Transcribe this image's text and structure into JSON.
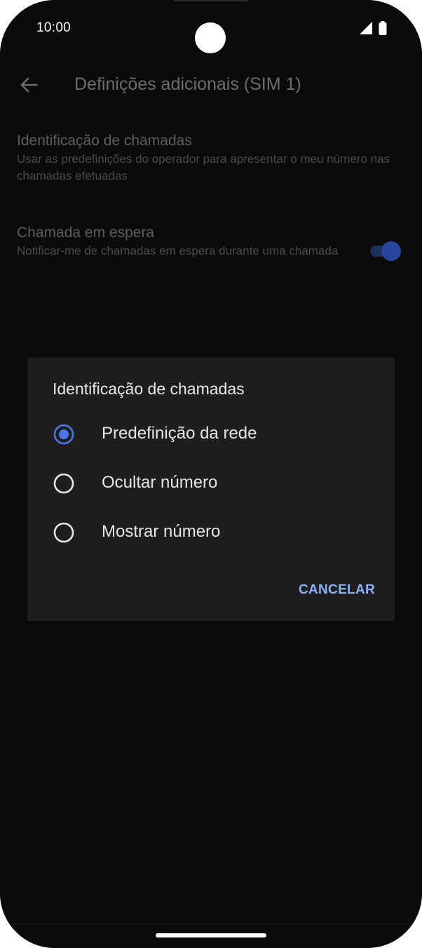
{
  "status_bar": {
    "time": "10:00",
    "signal_icon": "cell-signal-icon",
    "battery_icon": "battery-icon"
  },
  "app_bar": {
    "back_icon": "arrow-back-icon",
    "title": "Definições adicionais (SIM 1)"
  },
  "settings": [
    {
      "title": "Identificação de chamadas",
      "subtitle": "Usar as predefinições do operador para apresentar o meu número nas chamadas efetuadas"
    },
    {
      "title": "Chamada em espera",
      "subtitle": "Notificar-me de chamadas em espera durante uma chamada",
      "toggle_on": true
    }
  ],
  "dialog": {
    "title": "Identificação de chamadas",
    "options": [
      {
        "label": "Predefinição da rede",
        "selected": true
      },
      {
        "label": "Ocultar número",
        "selected": false
      },
      {
        "label": "Mostrar número",
        "selected": false
      }
    ],
    "cancel_label": "CANCELAR"
  },
  "colors": {
    "accent": "#8ab0f8",
    "radio_selected": "#4a78e8",
    "dialog_background": "#1e1e1e",
    "screen_background": "#0b0b0b"
  }
}
